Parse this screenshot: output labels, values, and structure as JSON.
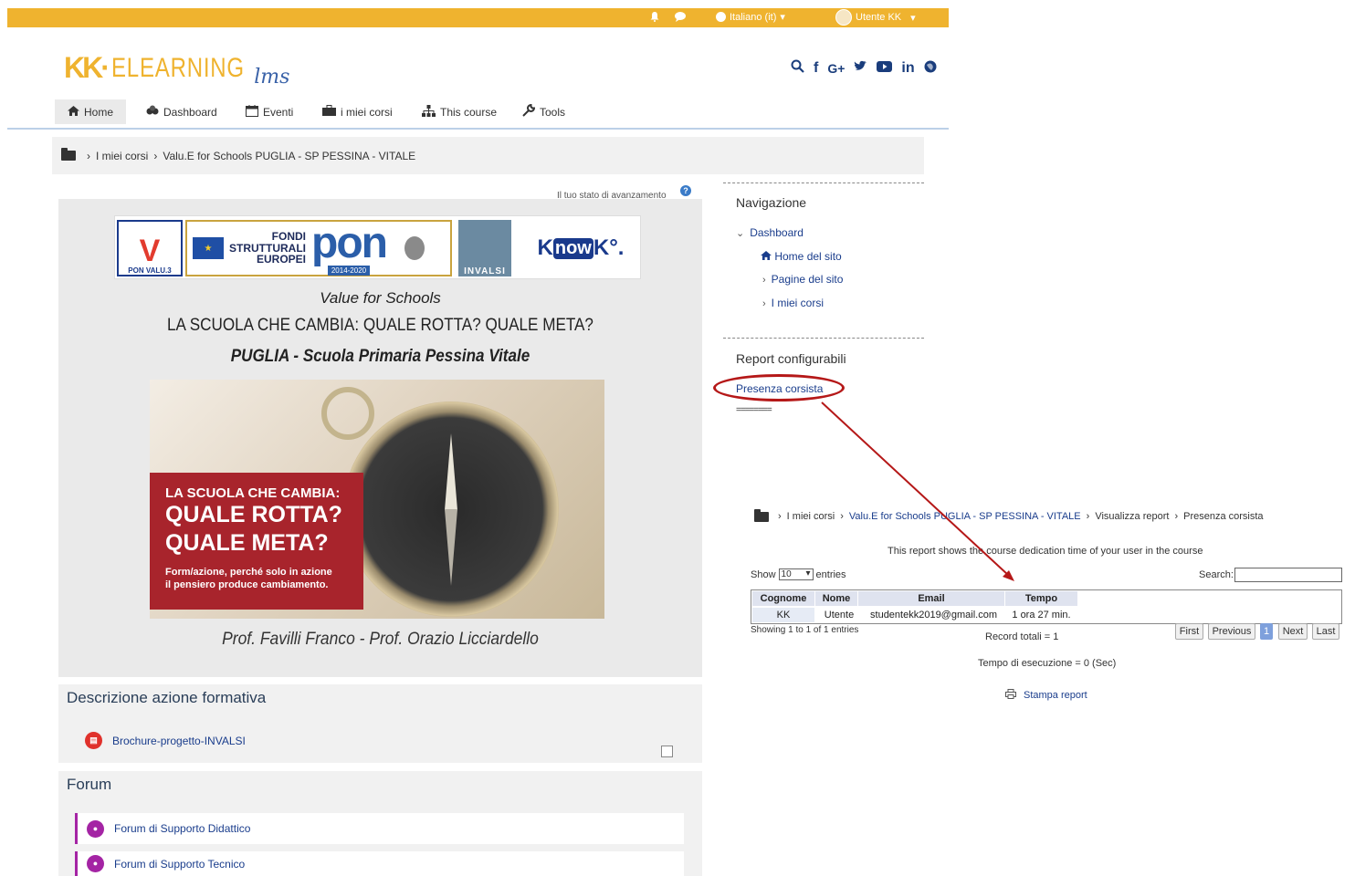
{
  "topbar": {
    "language": "Italiano (it)",
    "user": "Utente KK"
  },
  "header": {
    "logo_kk": "KK·",
    "logo_elearning": "ELEARNING",
    "logo_lms": "lms",
    "social": [
      "search-icon",
      "facebook-icon",
      "google-plus-icon",
      "twitter-icon",
      "youtube-icon",
      "linkedin-icon",
      "globe-icon"
    ]
  },
  "nav": {
    "items": [
      {
        "label": "Home",
        "icon": "home-icon"
      },
      {
        "label": "Dashboard",
        "icon": "dashboard-icon"
      },
      {
        "label": "Eventi",
        "icon": "calendar-icon"
      },
      {
        "label": "i miei corsi",
        "icon": "briefcase-icon"
      },
      {
        "label": "This course",
        "icon": "sitemap-icon"
      },
      {
        "label": "Tools",
        "icon": "wrench-icon"
      }
    ]
  },
  "breadcrumb": {
    "items": [
      "I miei corsi",
      "Valu.E for Schools PUGLIA - SP PESSINA - VITALE"
    ]
  },
  "main": {
    "progress_label": "Il tuo stato di avanzamento",
    "banner": {
      "v_text": "PON VALU.3",
      "fondi": "FONDI\nSTRUTTURALI\nEUROPEI",
      "pon": "pon",
      "pon_years": "2014-2020",
      "invalsi": "INVALSI",
      "knowk_pre": "K",
      "knowk_o": "now",
      "knowk_post": "K°."
    },
    "subtitle1": "Value for Schools",
    "subtitle2": "LA SCUOLA CHE CAMBIA: QUALE ROTTA? QUALE META?",
    "subtitle3": "PUGLIA - Scuola Primaria Pessina Vitale",
    "hero": {
      "line1": "LA SCUOLA CHE CAMBIA:",
      "line2": "QUALE ROTTA?",
      "line3": "QUALE META?",
      "line4": "Form/azione, perché solo in azione",
      "line5": "il pensiero produce cambiamento."
    },
    "authors": "Prof. Favilli Franco - Prof. Orazio Licciardello",
    "section1_title": "Descrizione azione formativa",
    "section1_resource": "Brochure-progetto-INVALSI",
    "section2_title": "Forum",
    "forums": [
      "Forum di Supporto Didattico",
      "Forum di Supporto Tecnico"
    ]
  },
  "sidebar": {
    "nav_title": "Navigazione",
    "dashboard": "Dashboard",
    "home": "Home del sito",
    "pages": "Pagine del sito",
    "courses": "I miei corsi",
    "report_title": "Report configurabili",
    "report_link": "Presenza corsista",
    "separator": "========"
  },
  "report": {
    "crumbs": [
      "I miei corsi",
      "Valu.E for Schools PUGLIA - SP PESSINA - VITALE",
      "Visualizza report",
      "Presenza corsista"
    ],
    "description": "This report shows the course dedication time of your user in the course",
    "show_label": "Show",
    "entries_value": "10",
    "entries_label": "entries",
    "search_label": "Search:",
    "columns": [
      "Cognome",
      "Nome",
      "Email",
      "Tempo"
    ],
    "row": [
      "KK",
      "Utente",
      "studentekk2019@gmail.com",
      "1 ora 27 min."
    ],
    "info": "Showing 1 to 1 of 1 entries",
    "total": "Record totali = 1",
    "pagination": [
      "First",
      "Previous",
      "1",
      "Next",
      "Last"
    ],
    "exec_time": "Tempo di esecuzione = 0 (Sec)",
    "print": "Stampa report"
  },
  "colors": {
    "topbar": "#efb32f",
    "annotation": "#b51818",
    "link": "#1a3d8c"
  }
}
